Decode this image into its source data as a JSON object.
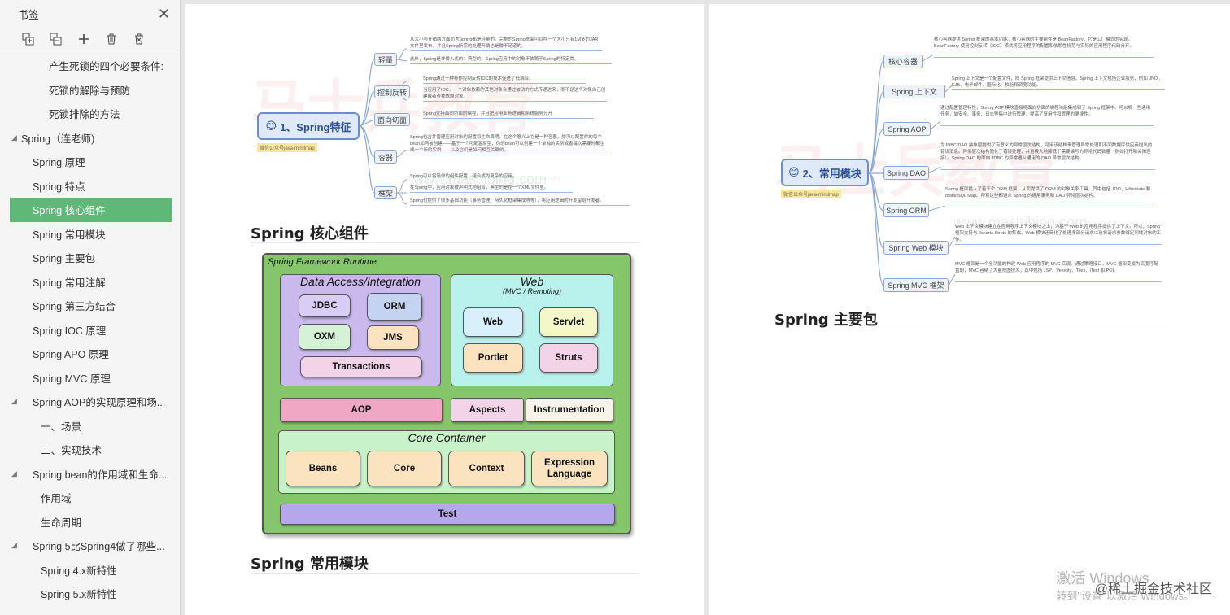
{
  "sidebar": {
    "title": "书签",
    "items": [
      {
        "label": "产生死锁的四个必要条件:",
        "level": 3
      },
      {
        "label": "死锁的解除与预防",
        "level": 3
      },
      {
        "label": "死锁排除的方法",
        "level": 3
      },
      {
        "label": "Spring（连老师)",
        "level": 1,
        "expanded": true
      },
      {
        "label": "Spring 原理",
        "level": 2
      },
      {
        "label": "Spring 特点",
        "level": 2
      },
      {
        "label": "Spring 核心组件",
        "level": 2,
        "active": true
      },
      {
        "label": "Spring 常用模块",
        "level": 2
      },
      {
        "label": "Spring 主要包",
        "level": 2
      },
      {
        "label": "Spring 常用注解",
        "level": 2
      },
      {
        "label": "Spring 第三方结合",
        "level": 2
      },
      {
        "label": "Spring IOC 原理",
        "level": 2
      },
      {
        "label": "Spring APO 原理",
        "level": 2
      },
      {
        "label": "Spring MVC 原理",
        "level": 2
      },
      {
        "label": "Spring AOP的实现原理和场...",
        "level": 2,
        "expanded": true
      },
      {
        "label": "一、场景",
        "level": 4
      },
      {
        "label": "二、实现技术",
        "level": 4
      },
      {
        "label": "Spring bean的作用域和生命...",
        "level": 2,
        "expanded": true
      },
      {
        "label": "作用域",
        "level": 4
      },
      {
        "label": "生命周期",
        "level": 4
      },
      {
        "label": "Spring 5比Spring4做了哪些...",
        "level": 2,
        "expanded": true
      },
      {
        "label": "Spring 4.x新特性",
        "level": 4
      },
      {
        "label": "Spring 5.x新特性",
        "level": 4
      }
    ]
  },
  "left_page": {
    "mindmap_root": "1、Spring特征",
    "mindmap_tag": "微信公众号java-mindmap",
    "branches": [
      "轻量",
      "控制反转",
      "面向切面",
      "容器",
      "框架"
    ],
    "descriptions": [
      "从大小与开销两方面而言Spring都是轻量的。完整的Spring框架可以在一个大小只有1M多的JAR文件里发布，并且Spring所需的处理开销也是微不足道的。",
      "此外，Spring是非侵入式的：典型的，Spring应用中的对象不依赖于Spring的特定类。",
      "Spring通过一种称作控制反转IOC的技术促进了低耦合。",
      "当应用了IOC，一个对象依赖的其他对象会通过被动的方式传递进来，而不是这个对象自己创建或者查找依赖对象。",
      "Spring支持面向切面的编程，并且把应用业务逻辑和系统服务分开",
      "Spring包含并管理应用对象的配置和生命周期，在这个意义上它是一种容器，你可以配置你的每个bean如何被创建——基于一个可配置原型，你的bean可以创建一个单独的实例或者每次需要时都生成一个新的实例——以及它们是如何相互关联的。",
      "Spring可以将简单的组件配置，组合成为复杂的应用。",
      "在Spring中，应用对象被声明式地组合，典型的是在一个XML文件里。",
      "Spring也提供了很多基础功能（事务管理、持久化框架集成等等），将应用逻辑的开发留给开发者。"
    ],
    "title_core": "Spring 核心组件",
    "title_modules": "Spring 常用模块",
    "runtime": {
      "title": "Spring Framework Runtime",
      "data_access": {
        "title": "Data Access/Integration",
        "items": [
          "JDBC",
          "ORM",
          "OXM",
          "JMS",
          "Transactions"
        ]
      },
      "web": {
        "title": "Web",
        "subtitle": "(MVC / Remoting)",
        "items": [
          "Web",
          "Servlet",
          "Portlet",
          "Struts"
        ]
      },
      "aop": "AOP",
      "aspects": "Aspects",
      "instrumentation": "Instrumentation",
      "core": {
        "title": "Core Container",
        "items": [
          "Beans",
          "Core",
          "Context",
          "Expression\nLanguage"
        ]
      },
      "test": "Test"
    }
  },
  "right_page": {
    "mindmap_root": "2、常用模块",
    "mindmap_tag": "微信公众号java-mindmap",
    "branches": [
      "核心容器",
      "Spring 上下文",
      "Spring AOP",
      "Spring DAO",
      "Spring ORM",
      "Spring Web 模块",
      "Spring MVC 框架"
    ],
    "descriptions": [
      "核心容器提供 Spring 框架的基本功能。核心容器的主要组件是 BeanFactory，它是工厂模式的实现。BeanFactory 使用控制反转（IOC）模式将应用程序的配置和依赖性规范与实际的应用程序代码分开。",
      "Spring 上下文是一个配置文件，向 Spring 框架提供上下文信息。Spring 上下文包括企业服务，例如 JNDI、EJB、电子邮件、国际化、校验和调度功能。",
      "通过配置管理特性，Spring AOP 模块直接将面向切面的编程功能集成到了 Spring 框架中。可以将一些通用任务，如安全、事务、日志等集中进行管理，提高了复用性和管理的便捷性。",
      "为JDBC DAO 抽象层提供了有意义的异常层次结构，可用该结构来管理异常处理和不同数据库供应商抛出的错误消息。异常层次结构简化了错误处理，并且极大地降低了需要编写的异常代码数量（例如打开和关闭连接）。Spring DAO 的面向 JDBC 的异常遵从通用的 DAO 异常层次结构。",
      "Spring 框架插入了若干个 ORM 框架，从而提供了 ORM 的对象关系工具，其中包括 JDO、Hibernate 和 iBatis SQL Map。所有这些都遵从 Spring 的通用事务和 DAO 异常层次结构。",
      "Web 上下文模块建立在应用程序上下文模块之上，为基于 Web 的应用程序提供了上下文。所以，Spring 框架支持与 Jakarta Struts 的集成。Web 模块还简化了处理多部分请求以及将请求参数绑定到域对象的工作。",
      "MVC 框架是一个全功能的构建 Web 应用程序的 MVC 实现。通过策略接口，MVC 框架变成为高度可配置的，MVC 容纳了大量视图技术，其中包括 JSP、Velocity、Tiles、iText 和 POI。"
    ],
    "title_packages": "Spring 主要包"
  },
  "watermarks": {
    "logo_text": "马士兵教育",
    "url": "www.mashibing.com",
    "windows_line1": "激活 Windows",
    "windows_line2": "转到\"设置\"以激活 Windows。",
    "juejin": "@稀土掘金技术社区"
  }
}
